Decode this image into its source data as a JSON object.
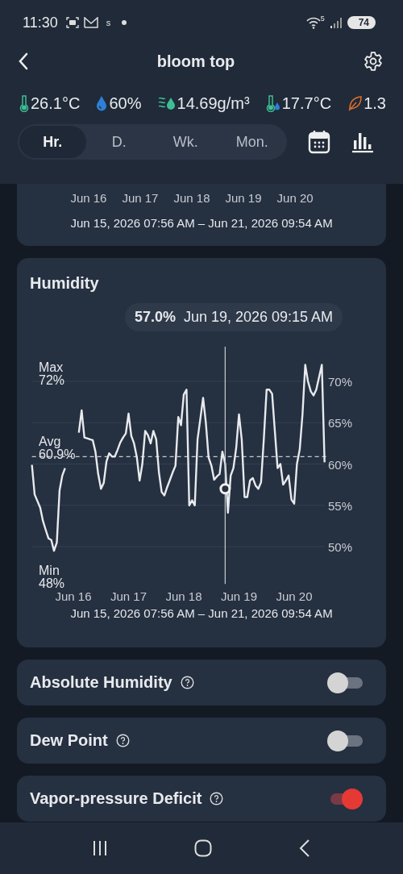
{
  "status_bar": {
    "time": "11:30",
    "app_letter": "s",
    "network_label": "5",
    "battery": "74"
  },
  "header": {
    "title": "bloom top"
  },
  "metrics": [
    {
      "kind": "temperature",
      "value": "26.1°C"
    },
    {
      "kind": "humidity",
      "value": "60%"
    },
    {
      "kind": "absolute_humidity",
      "value": "14.69g/m³"
    },
    {
      "kind": "dew_point",
      "value": "17.7°C"
    },
    {
      "kind": "vpd",
      "value": "1.3"
    }
  ],
  "tabs": [
    {
      "label": "Hr.",
      "selected": true
    },
    {
      "label": "D.",
      "selected": false
    },
    {
      "label": "Wk.",
      "selected": false
    },
    {
      "label": "Mon.",
      "selected": false
    }
  ],
  "previous_card": {
    "x_labels": [
      "Jun 16",
      "Jun 17",
      "Jun 18",
      "Jun 19",
      "Jun 20"
    ],
    "range": "Jun 15, 2026 07:56 AM – Jun 21, 2026 09:54 AM"
  },
  "humidity_card": {
    "title": "Humidity",
    "tooltip": {
      "value": "57.0%",
      "time": "Jun 19, 2026 09:15 AM"
    },
    "stats": [
      {
        "kind": "max",
        "label": "Max",
        "value": "72%"
      },
      {
        "kind": "avg",
        "label": "Avg",
        "value": "60.9%"
      },
      {
        "kind": "min",
        "label": "Min",
        "value": "48%"
      }
    ],
    "chart_data": {
      "type": "line",
      "categories": [
        null,
        null,
        null,
        null,
        null,
        null,
        null,
        null,
        null,
        null,
        null,
        null,
        null,
        null,
        null,
        "Jun 16",
        null,
        null,
        null,
        null,
        null,
        null,
        null,
        null,
        null,
        null,
        null,
        null,
        null,
        null,
        null,
        null,
        null,
        null,
        null,
        "Jun 17",
        null,
        null,
        null,
        null,
        null,
        null,
        null,
        null,
        null,
        null,
        null,
        null,
        null,
        null,
        null,
        null,
        null,
        null,
        null,
        "Jun 18",
        null,
        null,
        null,
        null,
        null,
        null,
        null,
        null,
        null,
        null,
        null,
        null,
        null,
        null,
        null,
        null,
        null,
        null,
        null,
        "Jun 19",
        null,
        null,
        null,
        null,
        null,
        null,
        null,
        null,
        null,
        null,
        null,
        null,
        null,
        null,
        null,
        null,
        null,
        null,
        null,
        "Jun 20",
        null,
        null,
        null,
        null,
        null,
        null,
        null,
        null,
        null,
        null,
        null
      ],
      "series": [
        {
          "color": "#e8eaed",
          "values": [
            59.9,
            56.3,
            55.5,
            54.7,
            53.1,
            52.0,
            51.0,
            50.8,
            49.5,
            50.5,
            56.8,
            58.6,
            59.5,
            null,
            null,
            null,
            null,
            63.8,
            66.5,
            63.2,
            63.1,
            63.0,
            62.9,
            61.5,
            58.8,
            57.0,
            57.7,
            60.3,
            61.3,
            60.9,
            60.9,
            61.7,
            62.6,
            63.2,
            63.7,
            66.1,
            63.4,
            62.5,
            60.8,
            58.0,
            60.0,
            64.0,
            63.5,
            62.5,
            64.0,
            63.0,
            59.0,
            56.6,
            56.2,
            57.2,
            58.1,
            59.0,
            59.8,
            65.7,
            64.7,
            68.4,
            69.0,
            55.0,
            55.6,
            55.0,
            63.0,
            65.5,
            68.0,
            65.0,
            60.8,
            59.8,
            58.1,
            58.5,
            58.8,
            61.5,
            60.0,
            54.1,
            58.6,
            59.5,
            62.0,
            66.0,
            63.0,
            56.0,
            56.0,
            58.0,
            58.3,
            57.4,
            57.0,
            57.8,
            63.0,
            69.0,
            69.0,
            68.5,
            64.0,
            59.5,
            60.0,
            57.5,
            58.0,
            58.6,
            55.7,
            55.2,
            60.0,
            61.8,
            66.0,
            72.0,
            70.0,
            68.8,
            68.3,
            69.0,
            70.5,
            72.0,
            60.2
          ]
        },
        {
          "color": "#f0f0f0",
          "marker": "o",
          "values": [
            null,
            null,
            null,
            null,
            null,
            null,
            null,
            null,
            null,
            null,
            null,
            null,
            null,
            null,
            null,
            null,
            null,
            null,
            null,
            null,
            null,
            null,
            null,
            null,
            null,
            null,
            null,
            null,
            null,
            null,
            null,
            null,
            null,
            null,
            null,
            null,
            null,
            null,
            null,
            null,
            null,
            null,
            null,
            null,
            null,
            null,
            null,
            null,
            null,
            null,
            null,
            null,
            null,
            null,
            null,
            null,
            null,
            null,
            null,
            null,
            null,
            null,
            null,
            null,
            null,
            null,
            null,
            null,
            null,
            null,
            57.0,
            null,
            null,
            null,
            null,
            null,
            null,
            null,
            null,
            null,
            null,
            null,
            null,
            null,
            null,
            null,
            null,
            null,
            null,
            null,
            null,
            null,
            null,
            null,
            null,
            null,
            null,
            null,
            null,
            null,
            null,
            null,
            null,
            null,
            null,
            null,
            null
          ]
        }
      ],
      "ylim": [
        45.5,
        74.3
      ],
      "grid": true,
      "yticks": [
        {
          "value": 50,
          "label": "50%"
        },
        {
          "value": 55,
          "label": "55%"
        },
        {
          "value": 60,
          "label": "60%"
        },
        {
          "value": 65,
          "label": "65%"
        },
        {
          "value": 70,
          "label": "70%"
        }
      ],
      "ref_lines": [
        {
          "axis": "y",
          "value": 60.9
        }
      ]
    },
    "range": "Jun 15, 2026 07:56 AM – Jun 21, 2026 09:54 AM"
  },
  "toggles": [
    {
      "label": "Absolute Humidity",
      "on": false
    },
    {
      "label": "Dew Point",
      "on": false
    },
    {
      "label": "Vapor-pressure Deficit",
      "on": true
    }
  ]
}
